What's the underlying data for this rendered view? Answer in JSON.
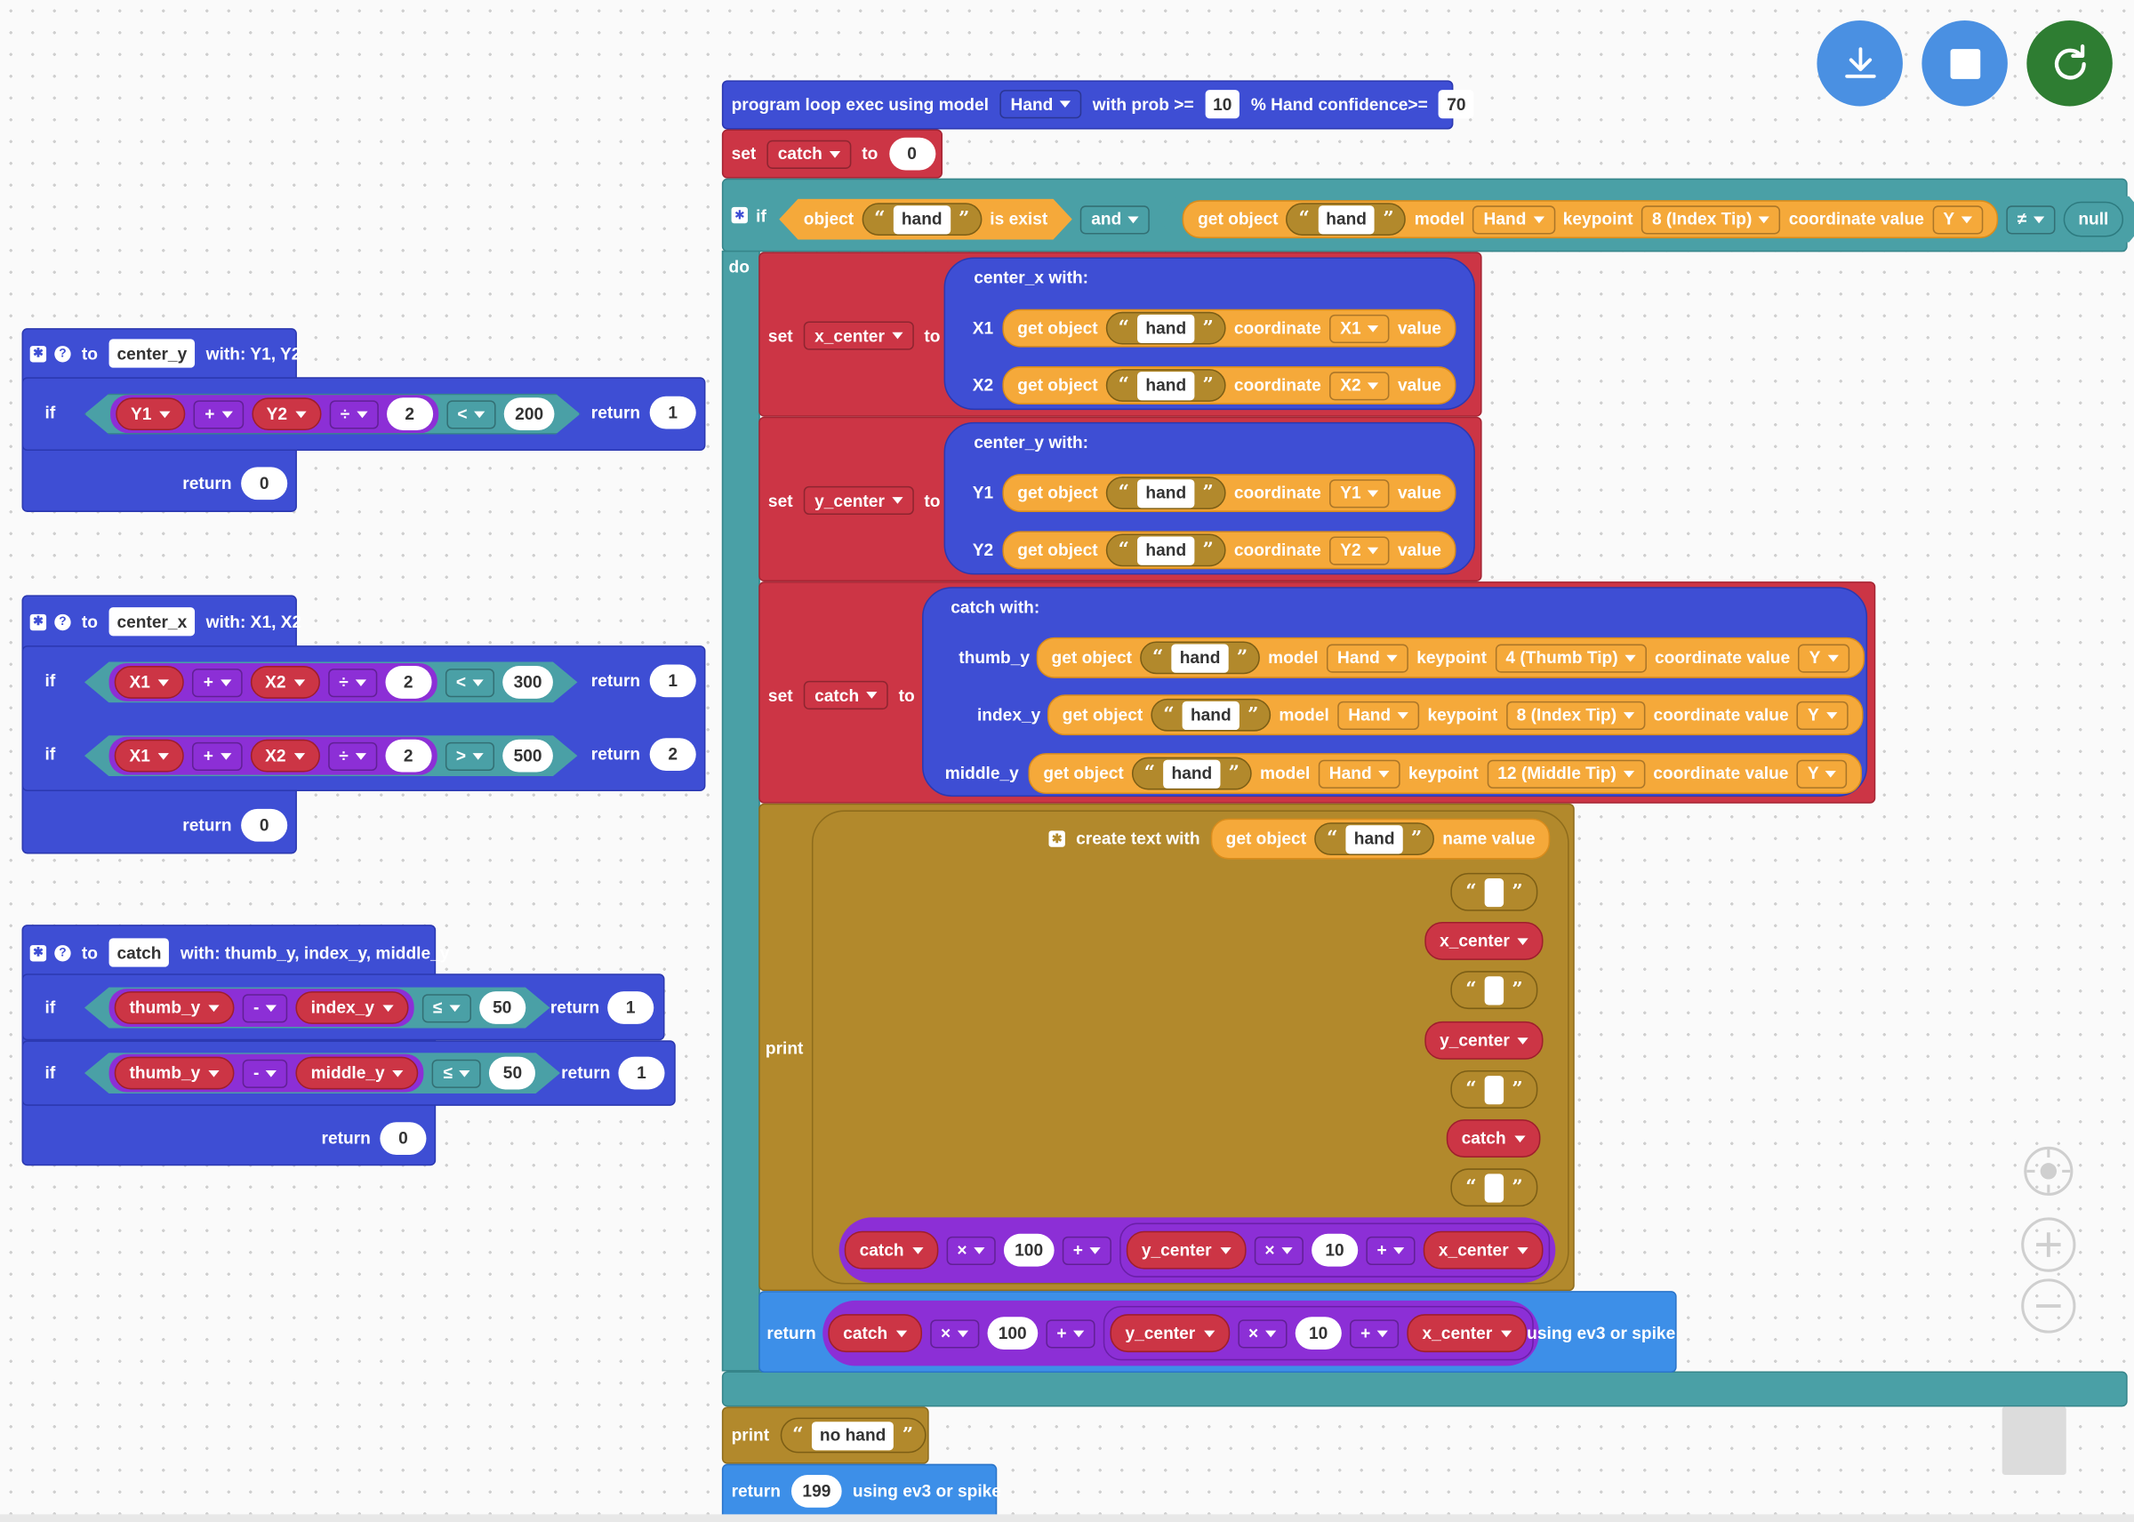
{
  "header": {
    "program_prefix": "program loop exec using model",
    "model": "Hand",
    "with_prob": "with prob >=",
    "prob_value": "10",
    "hand_conf_label": "% Hand confidence>=",
    "hand_conf_value": "70"
  },
  "set_catch_top": {
    "set": "set",
    "var": "catch",
    "to": "to",
    "value": "0"
  },
  "if_main": {
    "if": "if",
    "object": "object",
    "hand": "hand",
    "is_exist": "is exist",
    "and": "and",
    "get_object": "get object",
    "model_label": "model",
    "model": "Hand",
    "keypoint_label": "keypoint",
    "keypoint": "8 (Index Tip)",
    "coord_value": "coordinate value",
    "coord": "Y",
    "neq": "≠",
    "null": "null",
    "do": "do"
  },
  "set_x": {
    "set": "set",
    "var": "x_center",
    "to": "to",
    "fn": "center_x",
    "with": "with:",
    "p1": "X1",
    "p2": "X2",
    "get_object": "get object",
    "hand": "hand",
    "coordinate": "coordinate",
    "c1": "X1",
    "c2": "X2",
    "value": "value"
  },
  "set_y": {
    "set": "set",
    "var": "y_center",
    "to": "to",
    "fn": "center_y",
    "with": "with:",
    "p1": "Y1",
    "p2": "Y2",
    "get_object": "get object",
    "hand": "hand",
    "coordinate": "coordinate",
    "c1": "Y1",
    "c2": "Y2",
    "value": "value"
  },
  "set_catch": {
    "set": "set",
    "var": "catch",
    "to": "to",
    "fn": "catch",
    "with": "with:",
    "rows": [
      {
        "param": "thumb_y",
        "keypoint": "4 (Thumb Tip)"
      },
      {
        "param": "index_y",
        "keypoint": "8 (Index Tip)"
      },
      {
        "param": "middle_y",
        "keypoint": "12 (Middle Tip)"
      }
    ],
    "get_object": "get object",
    "hand": "hand",
    "model_label": "model",
    "model": "Hand",
    "keypoint_label": "keypoint",
    "coord_value": "coordinate value",
    "coord": "Y"
  },
  "print_block": {
    "print": "print",
    "create_text": "create text with",
    "get_object": "get object",
    "hand": "hand",
    "name_value": "name value",
    "v1": "x_center",
    "v2": "y_center",
    "v3": "catch"
  },
  "formula": {
    "v1": "catch",
    "op1": "×",
    "n1": "100",
    "op2": "+",
    "v2": "y_center",
    "op3": "×",
    "n2": "10",
    "op4": "+",
    "v3": "x_center"
  },
  "return_main": {
    "return": "return",
    "using": "using ev3 or spike"
  },
  "print_nohand": {
    "print": "print",
    "text": "no hand"
  },
  "return_199": {
    "return": "return",
    "value": "199",
    "using": "using ev3 or spike"
  },
  "func_center_y": {
    "to": "to",
    "name": "center_y",
    "with": "with: Y1, Y2",
    "if": "if",
    "a": "Y1",
    "op1": "+",
    "b": "Y2",
    "op2": "÷",
    "n": "2",
    "cmp": "<",
    "limit": "200",
    "return": "return",
    "ret1": "1",
    "ret0": "0"
  },
  "func_center_x": {
    "to": "to",
    "name": "center_x",
    "with": "with: X1, X2",
    "if": "if",
    "a": "X1",
    "op1": "+",
    "b": "X2",
    "op2": "÷",
    "n": "2",
    "cmp1": "<",
    "limit1": "300",
    "ret1": "1",
    "cmp2": ">",
    "limit2": "500",
    "ret2": "2",
    "return": "return",
    "ret0": "0"
  },
  "func_catch": {
    "to": "to",
    "name": "catch",
    "with": "with: thumb_y, index_y, middle_y",
    "if": "if",
    "a": "thumb_y",
    "op": "-",
    "b1": "index_y",
    "b2": "middle_y",
    "cmp": "≤",
    "limit": "50",
    "return": "return",
    "ret1": "1",
    "ret0": "0"
  },
  "controls": {
    "download": "download-icon",
    "stop": "stop-icon",
    "restart": "restart-icon"
  },
  "colors": {
    "blue": "#3e4ed4",
    "red": "#cc3545",
    "teal": "#4aa0a6",
    "olive": "#b2892c",
    "orange": "#f5a93a",
    "purple": "#8c2fd6",
    "green": "#2e7d32",
    "control_blue": "#4a90e2"
  }
}
